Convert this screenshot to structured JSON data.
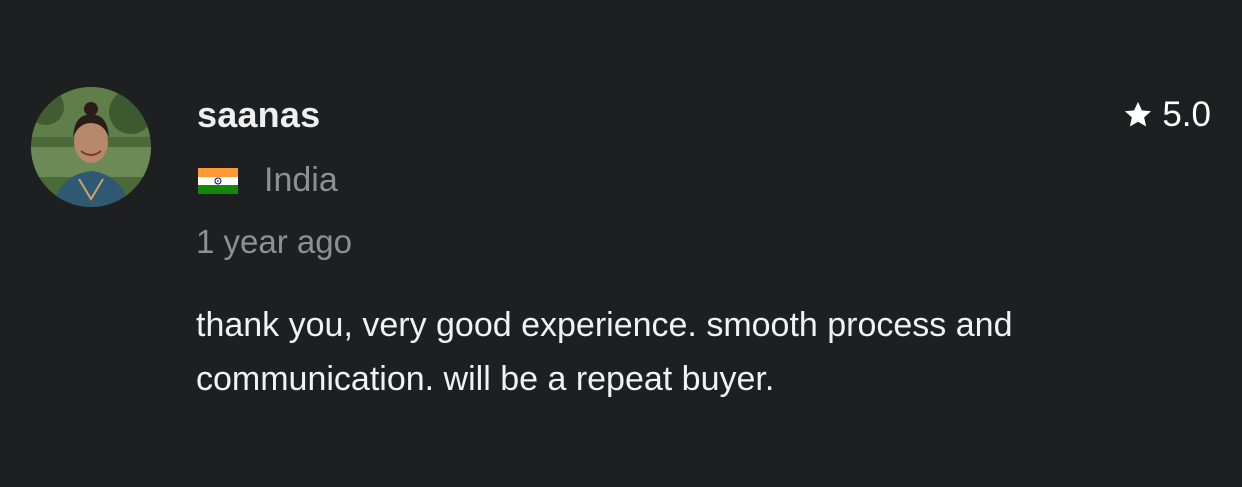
{
  "review": {
    "username": "saanas",
    "rating": "5.0",
    "rating_icon": "star-icon",
    "country": "India",
    "country_flag_icon": "india-flag-icon",
    "time_ago": "1 year ago",
    "text": "thank you, very good experience. smooth process and communication. will be a repeat buyer."
  },
  "colors": {
    "background": "#1e1f21",
    "primary_text": "#f0f0f0",
    "secondary_text": "#8e8f93"
  }
}
